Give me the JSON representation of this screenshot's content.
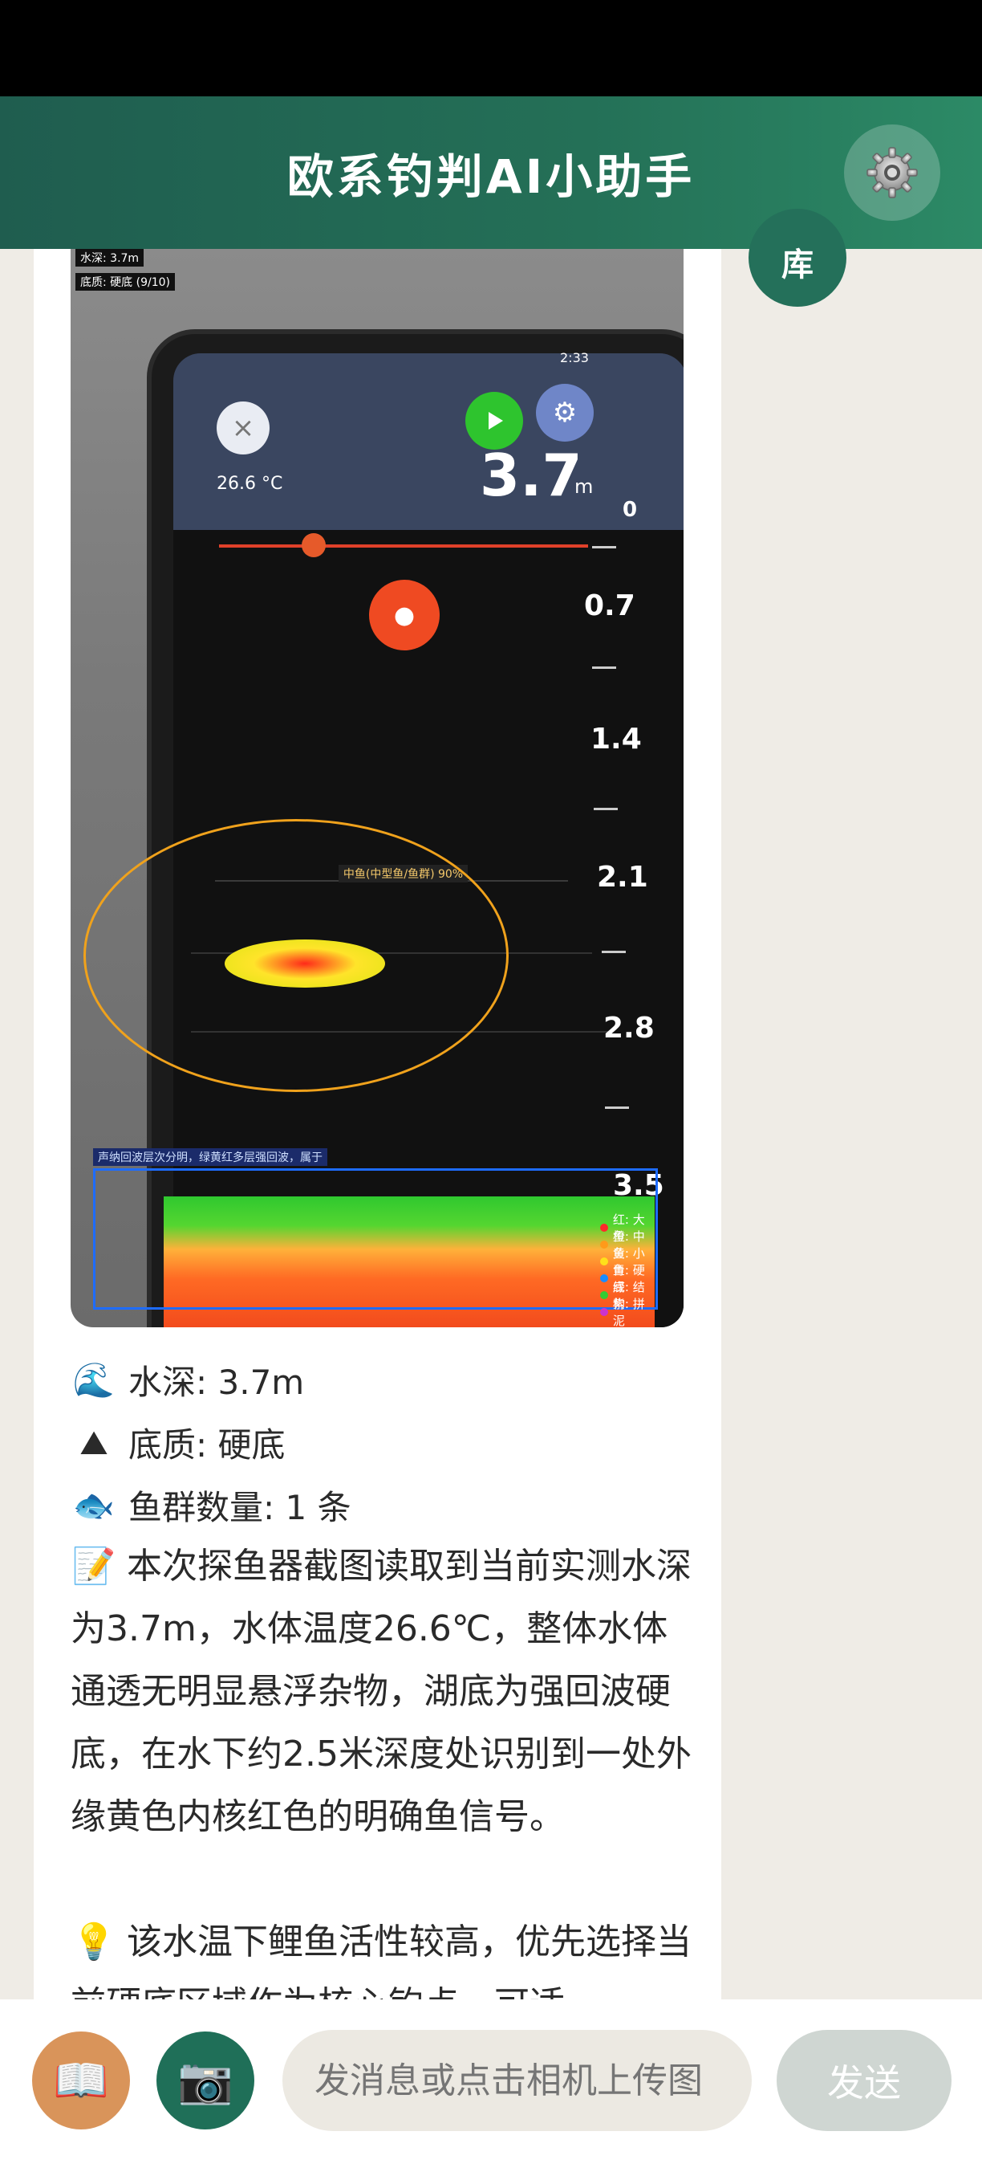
{
  "header": {
    "title": "欧系钓判AI小助手",
    "settings_icon": "gear-icon"
  },
  "side": {
    "library_label": "库"
  },
  "sonar_image": {
    "tag_depth": "水深: 3.7m",
    "tag_bottom": "底质: 硬底 (9/10)",
    "phone_temp": "26.6 °C",
    "phone_depth": "3.7",
    "phone_depth_unit": "m",
    "phone_time": "2:33",
    "depth_scale": [
      "0",
      "0.7",
      "1.4",
      "2.1",
      "2.8",
      "3.5"
    ],
    "fish_tag": "中鱼(中型鱼/鱼群) 90%",
    "bottom_tag": "声纳回波层次分明，绿黄红多层强回波，属于",
    "legend": [
      {
        "label": "红: 大鱼",
        "color": "#ff2a2a"
      },
      {
        "label": "橙: 中鱼",
        "color": "#ff9a1a"
      },
      {
        "label": "黄: 小鱼",
        "color": "#ffe01a"
      },
      {
        "label": "青: 硬底",
        "color": "#1a8cff"
      },
      {
        "label": "绿: 结构",
        "color": "#33cc33"
      },
      {
        "label": "紫: 拼泥",
        "color": "#cc33cc"
      }
    ]
  },
  "summary": {
    "depth": {
      "icon": "wave-icon",
      "glyph": "🌊",
      "text": "水深: 3.7m"
    },
    "bottom": {
      "icon": "mountain-icon",
      "glyph": "⛰",
      "text": "底质: 硬底"
    },
    "fish": {
      "icon": "fish-icon",
      "glyph": "🐟",
      "text": "鱼群数量: 1 条"
    }
  },
  "analysis": {
    "memo_glyph": "📝",
    "memo_text": "本次探鱼器截图读取到当前实测水深为3.7m，水体温度26.6℃，整体水体通透无明显悬浮杂物，湖底为强回波硬底，在水下约2.5米深度处识别到一处外缘黄色内核红色的明确鱼信号。",
    "tip_glyph": "💡",
    "tip_text": "该水温下鲤鱼活性较高，优先选择当前硬底区域作为核心钓点，可适"
  },
  "input_bar": {
    "book_glyph": "📖",
    "camera_glyph": "📷",
    "placeholder": "发消息或点击相机上传图",
    "send_label": "发送"
  },
  "colors": {
    "header": "#247057",
    "accent": "#24705a",
    "background": "#efece6"
  }
}
